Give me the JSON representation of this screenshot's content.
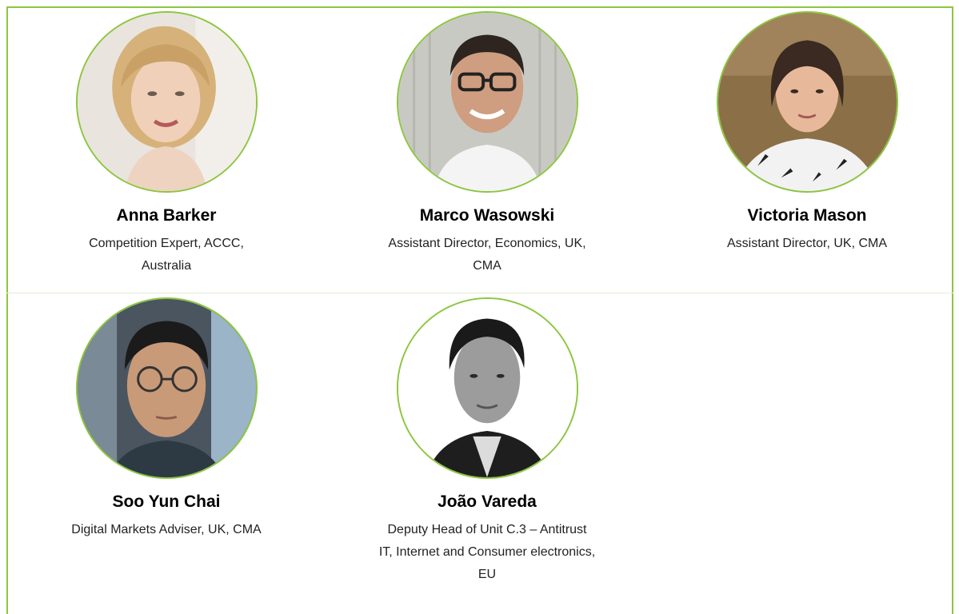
{
  "colors": {
    "accent": "#8dc63f"
  },
  "people": [
    {
      "name": "Anna Barker",
      "role_lines": [
        "Competition Expert, ACCC,",
        "Australia"
      ]
    },
    {
      "name": "Marco Wasowski",
      "role_lines": [
        "Assistant Director, Economics, UK,",
        "CMA"
      ]
    },
    {
      "name": "Victoria Mason",
      "role_lines": [
        "Assistant Director, UK, CMA"
      ]
    },
    {
      "name": "Soo Yun Chai",
      "role_lines": [
        "Digital Markets Adviser, UK, CMA"
      ]
    },
    {
      "name": "João Vareda",
      "role_lines": [
        "Deputy Head of Unit C.3 – Antitrust",
        "IT, Internet and Consumer electronics,",
        "EU"
      ]
    }
  ]
}
